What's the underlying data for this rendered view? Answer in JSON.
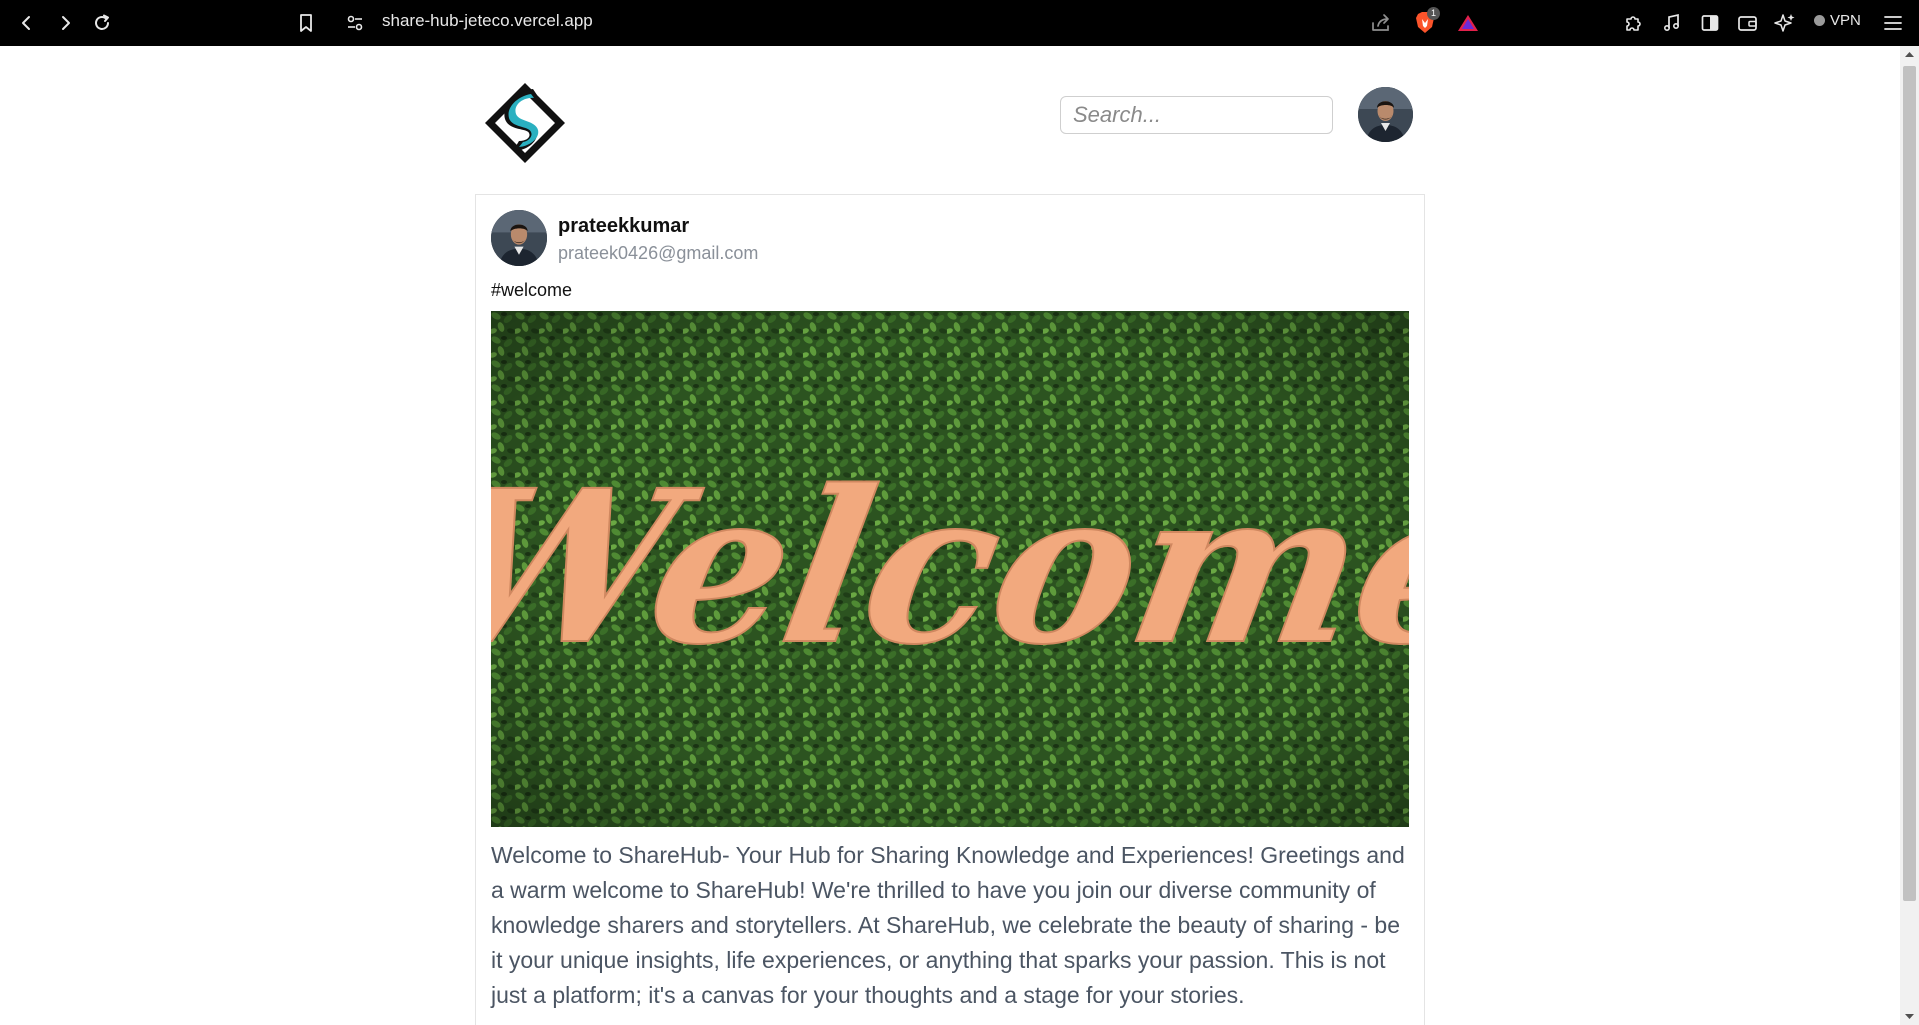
{
  "browser": {
    "url": "share-hub-jeteco.vercel.app",
    "shields_count": "1",
    "vpn_label": "VPN",
    "icons": [
      "back-icon",
      "forward-icon",
      "reload-icon",
      "bookmark-icon",
      "site-settings-icon",
      "share-icon",
      "brave-shields-icon",
      "brave-rewards-icon",
      "extensions-icon",
      "media-icon",
      "sidebar-icon",
      "wallet-icon",
      "leo-ai-icon",
      "menu-icon"
    ]
  },
  "header": {
    "logo": "sharehub-logo",
    "search_placeholder": "Search...",
    "avatar": "user-avatar"
  },
  "post": {
    "username": "prateekkumar",
    "email": "prateek0426@gmail.com",
    "tag": "#welcome",
    "image_text": "Welcome",
    "body": "Welcome to ShareHub- Your Hub for Sharing Knowledge and Experiences! Greetings and a warm welcome to ShareHub! We're thrilled to have you join our diverse community of knowledge sharers and storytellers. At ShareHub, we celebrate the beauty of sharing - be it your unique insights, life experiences, or anything that sparks your passion. This is not just a platform; it's a canvas for your thoughts and a stage for your stories."
  },
  "colors": {
    "chrome_bg": "#000000",
    "logo_teal": "#2ab0c0",
    "logo_dark": "#111111",
    "welcome_sign": "#f2a97e",
    "hedge_green": "#2f5a22",
    "body_text": "#4b5563",
    "muted_text": "#8a9099"
  }
}
